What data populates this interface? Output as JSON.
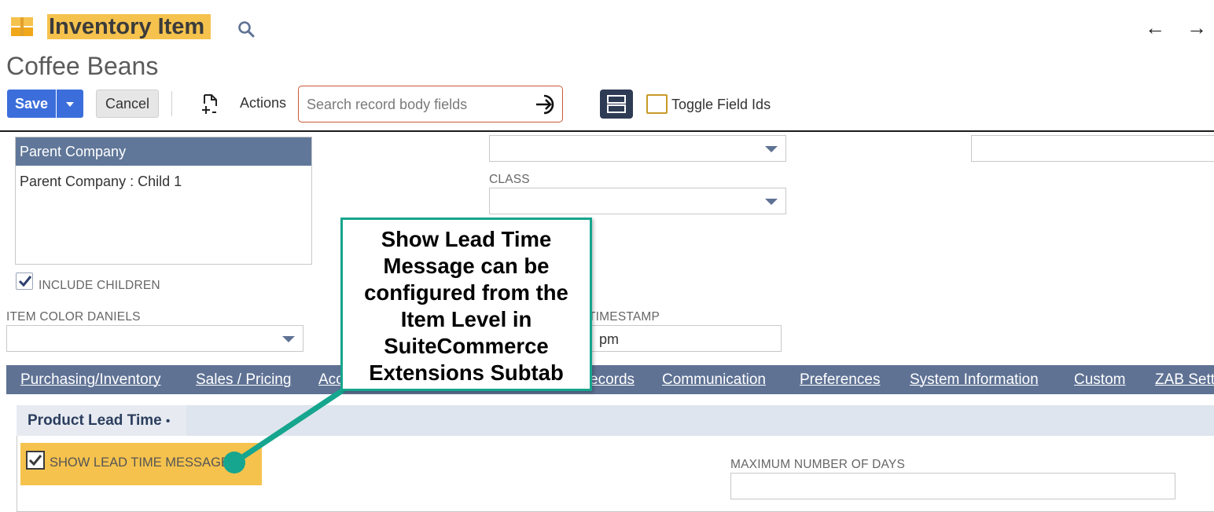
{
  "header": {
    "record_type": "Inventory Item",
    "record_name": "Coffee Beans",
    "icons": {
      "app": "inventory-box-icon",
      "search": "search-icon",
      "prev": "arrow-left-icon",
      "next": "arrow-right-icon"
    }
  },
  "toolbar": {
    "save_label": "Save",
    "cancel_label": "Cancel",
    "actions_label": "Actions",
    "search_placeholder": "Search record body fields",
    "toggle_field_ids_label": "Toggle Field Ids",
    "toggle_field_ids_checked": false
  },
  "form": {
    "subsidiary_options": [
      {
        "label": "Parent Company",
        "selected": true
      },
      {
        "label": "Parent Company : Child 1",
        "selected": false
      }
    ],
    "include_children": {
      "label": "INCLUDE CHILDREN",
      "checked": true
    },
    "top_select_value": "",
    "top_right_value": "",
    "class": {
      "label": "CLASS",
      "value": ""
    },
    "item_color": {
      "label": "ITEM COLOR DANIELS",
      "value": ""
    },
    "timestamp": {
      "label_visible": "TIMESTAMP",
      "value_visible": "pm"
    }
  },
  "tabs": [
    {
      "label": "Purchasing/Inventory"
    },
    {
      "label": "Sales / Pricing"
    },
    {
      "label": "Acc"
    },
    {
      "label": "ecords"
    },
    {
      "label": "Communication"
    },
    {
      "label": "Preferences"
    },
    {
      "label": "System Information"
    },
    {
      "label": "Custom"
    },
    {
      "label": "ZAB Sett"
    }
  ],
  "subtab": {
    "label": "Product Lead Time",
    "marker": "•",
    "show_lead_time_message": {
      "label": "SHOW LEAD TIME MESSAGE",
      "checked": true
    },
    "max_days": {
      "label": "MAXIMUM NUMBER OF DAYS",
      "value": ""
    }
  },
  "callout": {
    "text": "Show Lead Time Message can be configured from the Item Level in SuiteCommerce Extensions Subtab",
    "border_color": "#16a58e"
  },
  "colors": {
    "highlight": "#f5c24d",
    "primary_button": "#3c6edb",
    "tab_bar": "#5f7294",
    "dark_button": "#2e3b55"
  }
}
